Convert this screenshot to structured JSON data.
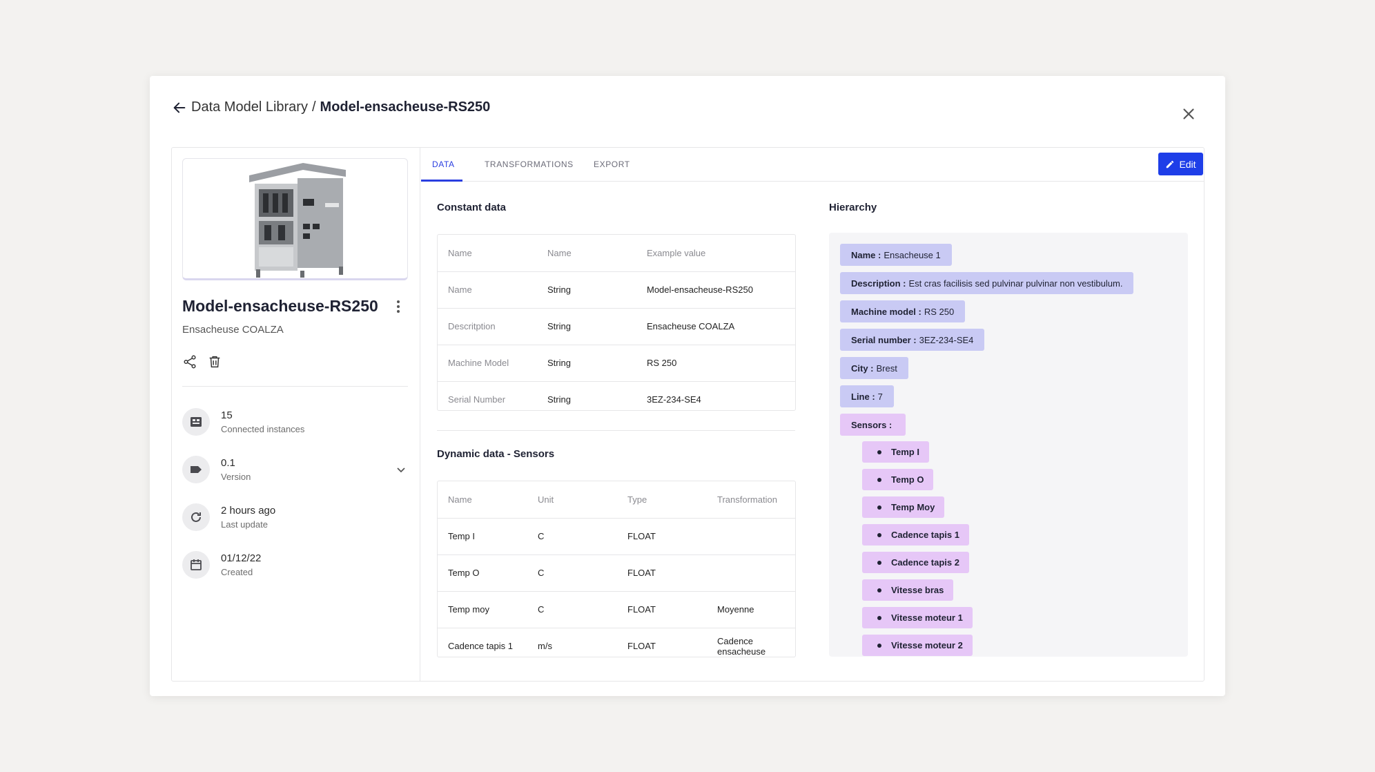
{
  "header": {
    "root": "Data Model Library",
    "separator": "/",
    "current": "Model-ensacheuse-RS250"
  },
  "model": {
    "title": "Model-ensacheuse-RS250",
    "subtitle": "Ensacheuse COALZA"
  },
  "meta": [
    {
      "value": "15",
      "label": "Connected instances",
      "icon": "instances-icon"
    },
    {
      "value": "0.1",
      "label": "Version",
      "icon": "tag-icon"
    },
    {
      "value": "2 hours ago",
      "label": "Last update",
      "icon": "refresh-icon"
    },
    {
      "value": "01/12/22",
      "label": "Created",
      "icon": "calendar-icon"
    }
  ],
  "tabs": [
    {
      "label": "DATA",
      "active": true
    },
    {
      "label": "TRANSFORMATIONS",
      "active": false
    },
    {
      "label": "EXPORT",
      "active": false
    }
  ],
  "edit_label": "Edit",
  "constant": {
    "title": "Constant data",
    "headers": [
      "Name",
      "Name",
      "Example value"
    ],
    "rows": [
      [
        "Name",
        "String",
        "Model-ensacheuse-RS250"
      ],
      [
        "Descritption",
        "String",
        "Ensacheuse COALZA"
      ],
      [
        "Machine Model",
        "String",
        "RS 250"
      ],
      [
        "Serial Number",
        "String",
        "3EZ-234-SE4"
      ]
    ]
  },
  "dynamic": {
    "title": "Dynamic data - Sensors",
    "headers": [
      "Name",
      "Unit",
      "Type",
      "Transformation"
    ],
    "rows": [
      [
        "Temp I",
        "C",
        "FLOAT",
        ""
      ],
      [
        "Temp O",
        "C",
        "FLOAT",
        ""
      ],
      [
        "Temp moy",
        "C",
        "FLOAT",
        "Moyenne"
      ],
      [
        "Cadence tapis 1",
        "m/s",
        "FLOAT",
        "Cadence ensacheuse"
      ]
    ]
  },
  "hierarchy": {
    "title": "Hierarchy",
    "fields": [
      {
        "key": "Name :",
        "value": "Ensacheuse 1"
      },
      {
        "key": "Description :",
        "value": "Est cras facilisis sed pulvinar pulvinar non vestibulum."
      },
      {
        "key": "Machine model :",
        "value": "RS 250"
      },
      {
        "key": "Serial number :",
        "value": "3EZ-234-SE4"
      },
      {
        "key": "City :",
        "value": "Brest"
      },
      {
        "key": "Line :",
        "value": "7"
      }
    ],
    "sensors_label": "Sensors :",
    "sensors": [
      "Temp I",
      "Temp O",
      "Temp Moy",
      "Cadence tapis 1",
      "Cadence tapis 2",
      "Vitesse bras",
      "Vitesse moteur 1",
      "Vitesse moteur 2"
    ]
  },
  "colors": {
    "accent": "#1e3ee8",
    "chip_blue": "#c9caf4",
    "chip_purple": "#e6c7f7"
  }
}
